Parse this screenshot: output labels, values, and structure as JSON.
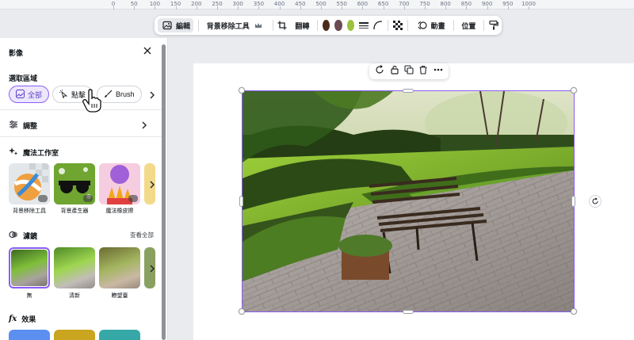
{
  "ruler": {
    "ticks": [
      "0",
      "50",
      "100",
      "150",
      "200",
      "250",
      "300",
      "350",
      "400",
      "450",
      "500",
      "550",
      "600",
      "650",
      "700",
      "750",
      "800",
      "850",
      "900",
      "950",
      "1000"
    ]
  },
  "toolbar": {
    "edit_label": "編輯",
    "bg_remover_label": "背景移除工具",
    "flip_label": "翻轉",
    "colors": [
      "#4a2a1a",
      "#6b4a52",
      "#9bc23c"
    ],
    "animate_label": "動畫",
    "position_label": "位置"
  },
  "panel": {
    "title": "影像",
    "select_area_label": "選取區域",
    "pills": [
      {
        "label": "全部",
        "icon": "image-icon"
      },
      {
        "label": "點擊",
        "icon": "magic-click-icon"
      },
      {
        "label": "Brush",
        "icon": "brush-icon"
      }
    ],
    "adjust_label": "調整",
    "magic_studio_label": "魔法工作室",
    "magic_tools": [
      {
        "label": "背景移除工具"
      },
      {
        "label": "背景產生器"
      },
      {
        "label": "魔法橡皮擦"
      }
    ],
    "filters_label": "濾鏡",
    "see_all_label": "查看全部",
    "filters": [
      {
        "label": "無"
      },
      {
        "label": "清新"
      },
      {
        "label": "瞭望臺"
      }
    ],
    "effects_label": "效果"
  },
  "canvas": {
    "image_description_icon": "park-bench-photo",
    "accent_color": "#8b5cf6"
  }
}
